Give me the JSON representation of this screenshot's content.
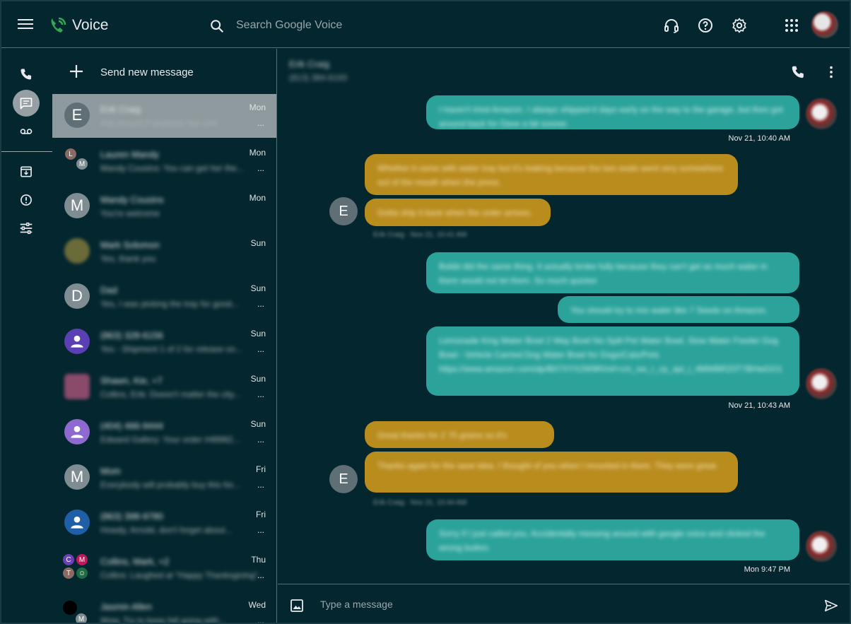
{
  "header": {
    "app_title": "Voice",
    "search_placeholder": "Search Google Voice",
    "icons": [
      "menu-icon",
      "voice-logo-icon",
      "search-icon",
      "headset-icon",
      "help-icon",
      "settings-icon",
      "apps-grid-icon",
      "account-avatar"
    ]
  },
  "rail": {
    "items": [
      "phone-icon",
      "messages-icon",
      "voicemail-icon",
      "archive-icon",
      "spam-icon",
      "filter-icon"
    ],
    "active": "messages-icon"
  },
  "list": {
    "new_message_label": "Send new message",
    "conversations": [
      {
        "initial": "E",
        "name": "Erik Craig",
        "snippet": "Ask around if anybody has one...",
        "time": "Mon",
        "dots": "...",
        "avatar_color": "#5f6f75"
      },
      {
        "initial": "",
        "name": "Lauren Mandy",
        "snippet": "Mandy Cousins: You can get her the...",
        "time": "Mon",
        "dots": "...",
        "avatar_color": "#5f6f75"
      },
      {
        "initial": "M",
        "name": "Mandy Cousins",
        "snippet": "You're welcome",
        "time": "Mon",
        "dots": "",
        "avatar_color": "#7f8c91"
      },
      {
        "initial": "",
        "name": "Mark Solomon",
        "snippet": "Yes, thank you",
        "time": "Sun",
        "dots": "",
        "avatar_color": "#6b6b3a"
      },
      {
        "initial": "D",
        "name": "Dad",
        "snippet": "Yes, I was picking the tray for good...",
        "time": "Sun",
        "dots": "...",
        "avatar_color": "#7f8c91"
      },
      {
        "initial": "",
        "name": "(863) 328-6156",
        "snippet": "Yes - Shipment 1 of 2 for release on...",
        "time": "Sun",
        "dots": "...",
        "avatar_color": "#5b3fb4"
      },
      {
        "initial": "",
        "name": "Shawn, Kie, +7",
        "snippet": "Collins, Erik: Doesn't matter the city...",
        "time": "Sun",
        "dots": "...",
        "avatar_color": "#8a4a6a"
      },
      {
        "initial": "",
        "name": "(404) 466-9444",
        "snippet": "Edward Gallery: Your order #48982...",
        "time": "Sun",
        "dots": "...",
        "avatar_color": "#8e6ad0"
      },
      {
        "initial": "M",
        "name": "Mom",
        "snippet": "Everybody will probably buy this for...",
        "time": "Fri",
        "dots": "...",
        "avatar_color": "#7f8c91"
      },
      {
        "initial": "",
        "name": "(863) 398-9780",
        "snippet": "Howdy, Arnold, don't forget about...",
        "time": "Fri",
        "dots": "...",
        "avatar_color": "#1f5fa8"
      },
      {
        "initial": "",
        "name": "Collins, Mark, +2",
        "snippet": "Collins: Laughed at \"Happy Thanksgiving\"...",
        "time": "Thu",
        "dots": "...",
        "avatar_color": "#8e44ad"
      },
      {
        "initial": "",
        "name": "Jasmin Allen",
        "snippet": "Wow, Try to keep fall going with...",
        "time": "Wed",
        "dots": "...",
        "avatar_color": "#000000"
      }
    ]
  },
  "chat": {
    "contact_name": "Erik Craig",
    "contact_number": "(813) 384-6193",
    "compose_placeholder": "Type a message",
    "messages": [
      {
        "dir": "out",
        "text": "I haven't tried Amazon. I always shipped it days early on the way to the garage, but then got around back for Dave a bit sooner."
      },
      {
        "stamp": "Nov 21, 10:40 AM"
      },
      {
        "dir": "in",
        "initial": "E",
        "text": "Whether it came with water tray but it's leaking because the two seals went very somewhere out of the mouth when the press."
      },
      {
        "dir": "in",
        "text": "Gotta ship it back when the order arrives."
      },
      {
        "stamp_them": "Erik Craig · Nov 21, 10:41 AM"
      },
      {
        "dir": "out",
        "text": "Bobbi did the same thing. It actually broke fully because they can't get as much water in there would not let them. So much quicker"
      },
      {
        "dir": "out",
        "text": "You should try to mix water like 7 Seeds on Amazon."
      },
      {
        "dir": "out",
        "text": "Lemonade King Water Bowl 2 Way Bowl No-Spill Pet Water Bowl, Slow Water Feeder Dog Bowl - Vehicle Carried Dog Water Bowl for Dogs/Cats/Pets https://www.amazon.com/dp/B07XYX2W9R/ref=cm_sw_r_cp_api_i_4MWBRZ0T7BHwGO1"
      },
      {
        "stamp": "Nov 21, 10:43 AM"
      },
      {
        "dir": "in",
        "initial": "E",
        "text": "Great thanks for 2 75 grams so it's"
      },
      {
        "dir": "in",
        "text": "Thanks again for the save idea. I thought of you when I mounted in there. They were great."
      },
      {
        "stamp_them": "Erik Craig · Nov 21, 10:44 AM"
      },
      {
        "dir": "out",
        "text": "Sorry if I just called you. Accidentally messing around with google voice and clicked the wrong button."
      },
      {
        "stamp": "Mon 9:47 PM"
      }
    ]
  }
}
